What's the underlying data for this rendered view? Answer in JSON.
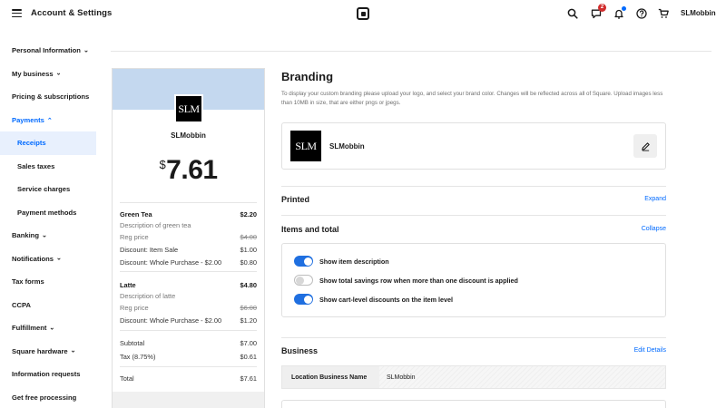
{
  "header": {
    "title": "Account & Settings",
    "messages_badge": "2",
    "user_name": "SLMobbin"
  },
  "sidebar": {
    "items": [
      {
        "label": "Personal Information",
        "chevron": "down"
      },
      {
        "label": "My business",
        "chevron": "down"
      },
      {
        "label": "Pricing & subscriptions"
      },
      {
        "label": "Payments",
        "chevron": "up"
      },
      {
        "label": "Receipts"
      },
      {
        "label": "Sales taxes"
      },
      {
        "label": "Service charges"
      },
      {
        "label": "Payment methods"
      },
      {
        "label": "Banking",
        "chevron": "down"
      },
      {
        "label": "Notifications",
        "chevron": "down"
      },
      {
        "label": "Tax forms"
      },
      {
        "label": "CCPA"
      },
      {
        "label": "Fulfillment",
        "chevron": "down"
      },
      {
        "label": "Square hardware",
        "chevron": "down"
      },
      {
        "label": "Information requests"
      },
      {
        "label": "Get free processing"
      }
    ]
  },
  "receipt": {
    "logo_text": "SLM",
    "business_name": "SLMobbin",
    "currency": "$",
    "total_big": "7.61",
    "items": [
      {
        "name": "Green Tea",
        "price": "$2.20",
        "description": "Description of green tea",
        "reg_label": "Reg price",
        "reg_price": "$4.00",
        "discount1_label": "Discount: Item Sale",
        "discount1_value": "$1.00",
        "discount2_label": "Discount: Whole Purchase - $2.00",
        "discount2_value": "$0.80"
      },
      {
        "name": "Latte",
        "price": "$4.80",
        "description": "Description of latte",
        "reg_label": "Reg price",
        "reg_price": "$6.00",
        "discount1_label": "Discount: Whole Purchase - $2.00",
        "discount1_value": "$1.20"
      }
    ],
    "subtotal_label": "Subtotal",
    "subtotal_value": "$7.00",
    "tax_label": "Tax (8.75%)",
    "tax_value": "$0.61",
    "total_label": "Total",
    "total_value": "$7.61"
  },
  "branding": {
    "title": "Branding",
    "description": "To display your custom branding please upload your logo, and select your brand color. Changes will be reflected across all of Square. Upload images less than 10MB in size, that are either pngs or jpegs.",
    "logo_text": "SLM",
    "business_name": "SLMobbin"
  },
  "printed": {
    "title": "Printed",
    "link": "Expand"
  },
  "items_total": {
    "title": "Items and total",
    "link": "Collapse",
    "toggles": [
      {
        "label": "Show item description",
        "on": true
      },
      {
        "label": "Show total savings row when more than one discount is applied",
        "on": false
      },
      {
        "label": "Show cart-level discounts on the item level",
        "on": true
      }
    ]
  },
  "business": {
    "title": "Business",
    "link": "Edit Details",
    "location_label": "Location Business Name",
    "location_value": "SLMobbin"
  },
  "colors": {
    "accent": "#006aff",
    "receipt_header": "#c4d8ef",
    "toggle_on": "#1f6fe0",
    "badge": "#d12d2d"
  }
}
